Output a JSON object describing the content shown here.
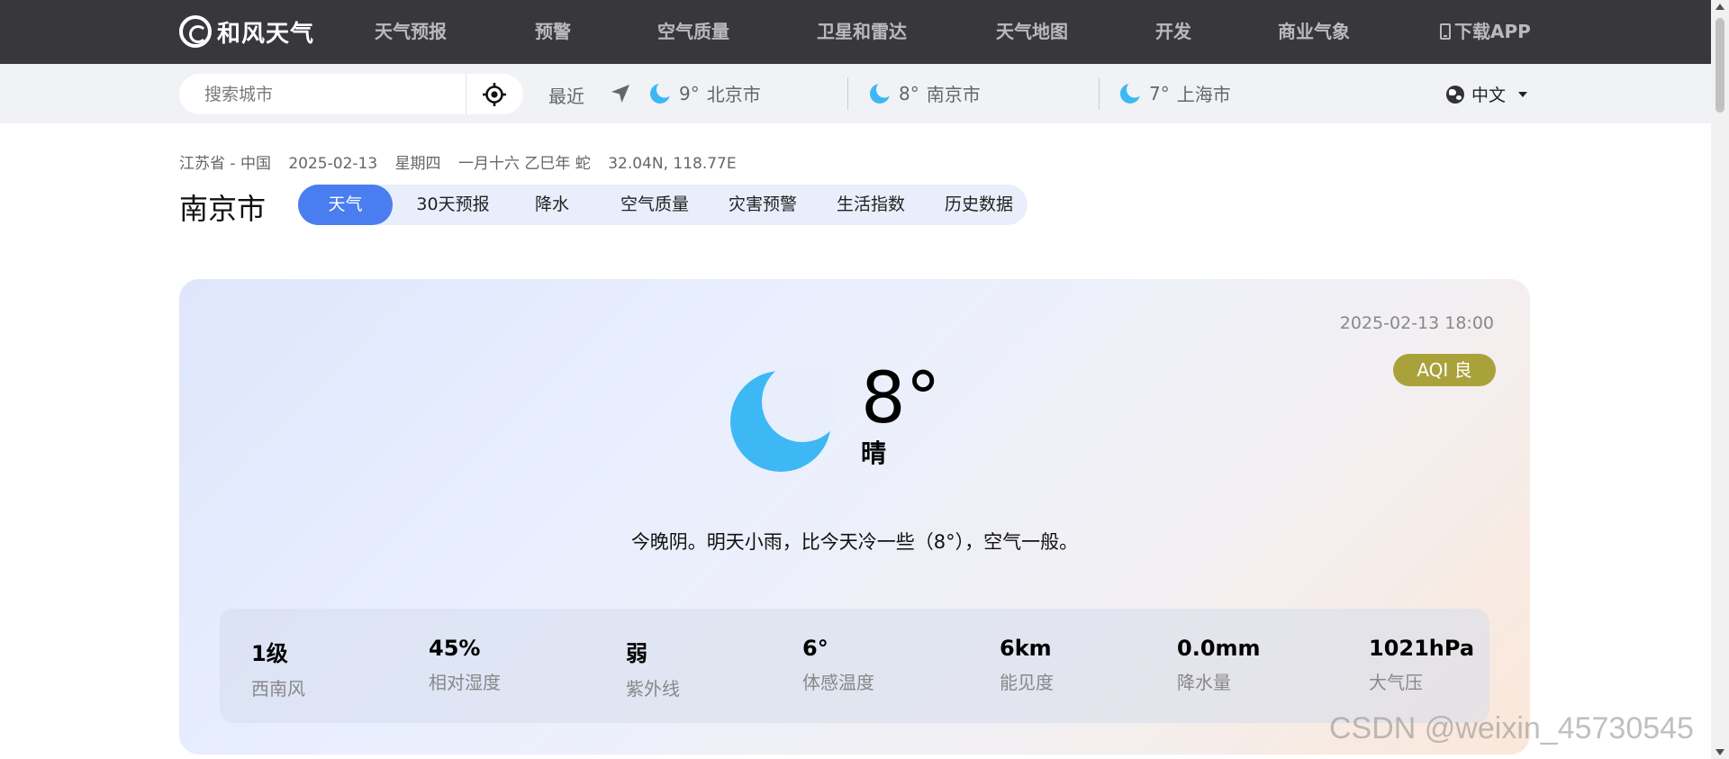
{
  "brand": {
    "name": "和风天气",
    "icon": "hefeng-logo-icon"
  },
  "nav": {
    "items": [
      "天气预报",
      "预警",
      "空气质量",
      "卫星和雷达",
      "天气地图",
      "开发",
      "商业气象"
    ],
    "download": "下载APP"
  },
  "search": {
    "placeholder": "搜索城市",
    "recent_label": "最近"
  },
  "recent_cities": [
    {
      "temp": "9°",
      "name": "北京市",
      "icon": "moon-icon"
    },
    {
      "temp": "8°",
      "name": "南京市",
      "icon": "moon-icon"
    },
    {
      "temp": "7°",
      "name": "上海市",
      "icon": "moon-icon"
    }
  ],
  "language": "中文",
  "location": {
    "region": "江苏省 - 中国",
    "date": "2025-02-13",
    "weekday": "星期四",
    "lunar": "一月十六 乙巳年 蛇",
    "coords": "32.04N, 118.77E",
    "city": "南京市"
  },
  "tabs": [
    "天气",
    "30天预报",
    "降水",
    "空气质量",
    "灾害预警",
    "生活指数",
    "历史数据"
  ],
  "current": {
    "obs_time": "2025-02-13 18:00",
    "aqi_label": "AQI 良",
    "temp": "8°",
    "condition": "晴",
    "summary": "今晚阴。明天小雨，比今天冷一些（8°），空气一般。",
    "details": [
      {
        "value": "1级",
        "label": "西南风"
      },
      {
        "value": "45%",
        "label": "相对湿度"
      },
      {
        "value": "弱",
        "label": "紫外线"
      },
      {
        "value": "6°",
        "label": "体感温度"
      },
      {
        "value": "6km",
        "label": "能见度"
      },
      {
        "value": "0.0mm",
        "label": "降水量"
      },
      {
        "value": "1021hPa",
        "label": "大气压"
      }
    ]
  },
  "watermark": "CSDN @weixin_45730545",
  "colors": {
    "nav_bg": "#38383c",
    "accent": "#4a7df0",
    "moon": "#3db8f5",
    "aqi_good": "#a9a23a"
  }
}
